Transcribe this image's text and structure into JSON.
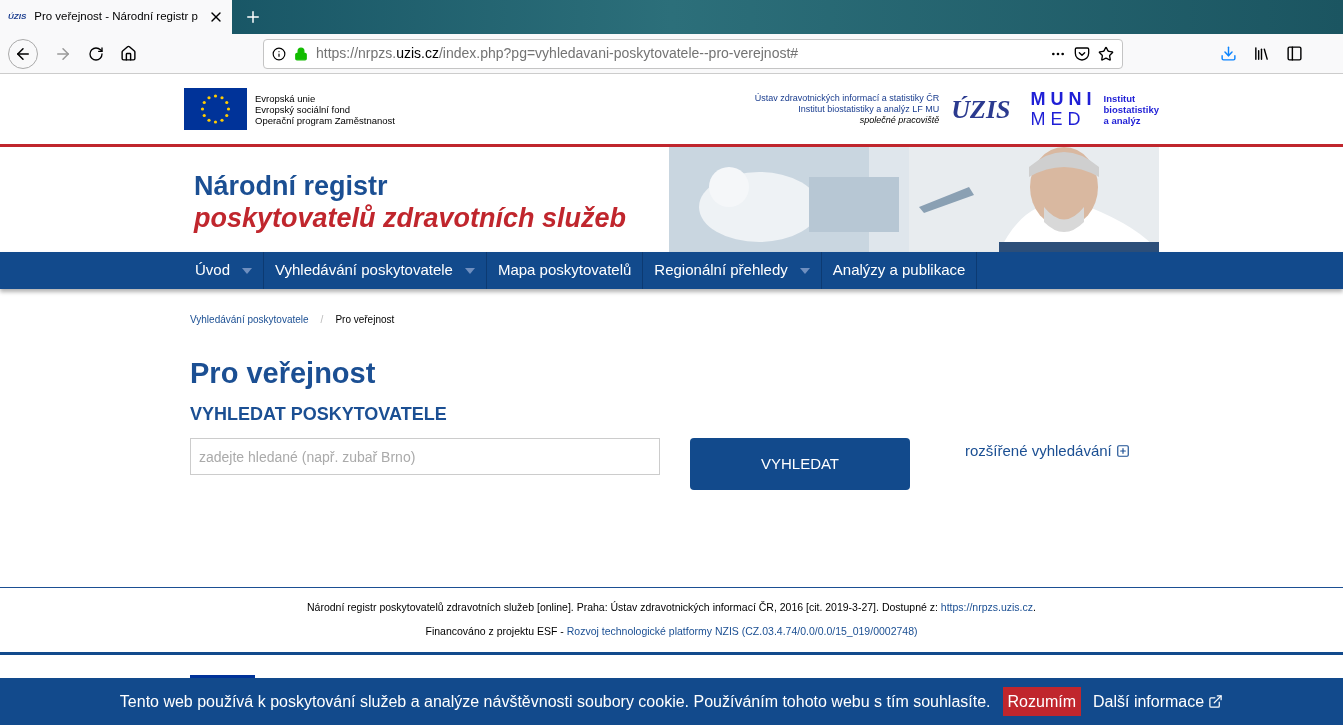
{
  "browser": {
    "site_icon": "ÚZIS",
    "tab_title": "Pro veřejnost - Národní registr p",
    "url_prefix": "https://nrpzs.",
    "url_domain": "uzis.cz",
    "url_path": "/index.php?pg=vyhledavani-poskytovatele--pro-verejnost#"
  },
  "header": {
    "eu_lines": [
      "Evropská unie",
      "Evropský sociální fond",
      "Operační program Zaměstnanost"
    ],
    "partner_lines": [
      "Ústav zdravotnických informací a statistiky ČR",
      "Institut biostatistiky a analýz LF MU"
    ],
    "partner_note": "společné pracoviště",
    "uzis_logo": "ÚZIS",
    "muni_top": "M U N I",
    "muni_bottom": "M E D",
    "institute_lines": [
      "Institut",
      "biostatistiky",
      "a analýz"
    ]
  },
  "banner": {
    "title_line1": "Národní registr",
    "title_line2": "poskytovatelů zdravotních služeb"
  },
  "nav": [
    {
      "label": "Úvod",
      "has_dropdown": true
    },
    {
      "label": "Vyhledávání poskytovatele",
      "has_dropdown": true
    },
    {
      "label": "Mapa poskytovatelů",
      "has_dropdown": false
    },
    {
      "label": "Regionální přehledy",
      "has_dropdown": true
    },
    {
      "label": "Analýzy a publikace",
      "has_dropdown": false
    }
  ],
  "breadcrumb": [
    {
      "label": "Vyhledávání poskytovatele",
      "link": true
    },
    {
      "label": "Pro veřejnost",
      "link": false
    }
  ],
  "breadcrumb_separator": "/",
  "page_title": "Pro veřejnost",
  "search": {
    "heading": "VYHLEDAT POSKYTOVATELE",
    "placeholder": "zadejte hledané (např. zubař Brno)",
    "button": "VYHLEDAT",
    "advanced_link": "rozšířené vyhledávání"
  },
  "footer": {
    "citation": "Národní registr poskytovatelů zdravotních služeb [online]. Praha: Ústav zdravotnických informací ČR, 2016 [cit. 2019-3-27]. Dostupné z:",
    "citation_link": "https://nrpzs.uzis.cz",
    "citation_end": ".",
    "funding": "Financováno z projektu ESF -",
    "funding_link": "Rozvoj technologické platformy NZIS (CZ.03.4.74/0.0/0.0/15_019/0002748)"
  },
  "cookie_bar": {
    "text": "Tento web používá k poskytování služeb a analýze návštěvnosti soubory cookie. Používáním tohoto webu s tím souhlasíte.",
    "accept": "Rozumím",
    "more": "Další informace"
  }
}
